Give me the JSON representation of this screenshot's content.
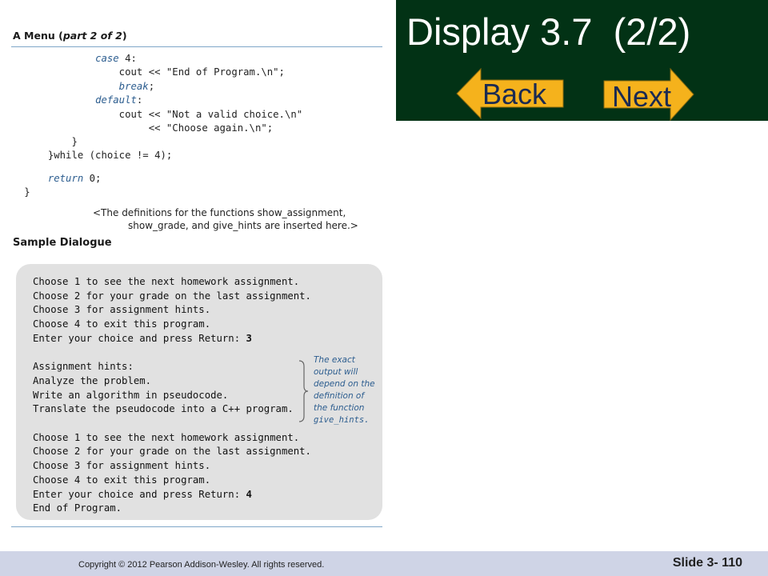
{
  "figure": {
    "title_prefix": "A Menu (",
    "title_italic": "part 2 of 2",
    "title_suffix": ")",
    "code_lines": [
      {
        "indent": "               ",
        "kw": "case",
        "rest": " 4:"
      },
      {
        "indent": "                   ",
        "kw": "",
        "rest": "cout << \"End of Program.\\n\";"
      },
      {
        "indent": "                   ",
        "kw": "break",
        "rest": ";"
      },
      {
        "indent": "               ",
        "kw": "default",
        "rest": ":"
      },
      {
        "indent": "                   ",
        "kw": "",
        "rest": "cout << \"Not a valid choice.\\n\""
      },
      {
        "indent": "                        ",
        "kw": "",
        "rest": "<< \"Choose again.\\n\";"
      },
      {
        "indent": "           ",
        "kw": "",
        "rest": "}"
      },
      {
        "indent": "       ",
        "kw": "",
        "rest": "}while (choice != 4);"
      },
      {
        "indent": "",
        "kw": "",
        "rest": ""
      },
      {
        "indent": "       ",
        "kw": "return",
        "rest": " 0;"
      },
      {
        "indent": "   ",
        "kw": "",
        "rest": "}"
      }
    ],
    "note_line1": "<The definitions for the functions show_assignment,",
    "note_line2": "show_grade, and give_hints are inserted here.>",
    "sample_title": "Sample Dialogue",
    "dialogue_lines": [
      {
        "text": "Choose 1 to see the next homework assignment.",
        "input": ""
      },
      {
        "text": "Choose 2 for your grade on the last assignment.",
        "input": ""
      },
      {
        "text": "Choose 3 for assignment hints.",
        "input": ""
      },
      {
        "text": "Choose 4 to exit this program.",
        "input": ""
      },
      {
        "text": "Enter your choice and press Return: ",
        "input": "3"
      },
      {
        "text": "",
        "input": ""
      },
      {
        "text": "Assignment hints:",
        "input": ""
      },
      {
        "text": "Analyze the problem.",
        "input": ""
      },
      {
        "text": "Write an algorithm in pseudocode.",
        "input": ""
      },
      {
        "text": "Translate the pseudocode into a C++ program.",
        "input": ""
      },
      {
        "text": "",
        "input": ""
      },
      {
        "text": "Choose 1 to see the next homework assignment.",
        "input": ""
      },
      {
        "text": "Choose 2 for your grade on the last assignment.",
        "input": ""
      },
      {
        "text": "Choose 3 for assignment hints.",
        "input": ""
      },
      {
        "text": "Choose 4 to exit this program.",
        "input": ""
      },
      {
        "text": "Enter your choice and press Return: ",
        "input": "4"
      },
      {
        "text": "End of Program.",
        "input": ""
      }
    ],
    "annotation_lines": [
      "The exact",
      "output will",
      "depend on the",
      "definition of",
      "the function"
    ],
    "annotation_func": "give_hints."
  },
  "slide": {
    "title": "Display 3.7  (2/2)",
    "back_label": "Back",
    "next_label": "Next"
  },
  "footer": {
    "copyright": "Copyright © 2012 Pearson Addison-Wesley.  All rights reserved.",
    "slide_number": "Slide 3- 110"
  },
  "colors": {
    "title_bg": "#023215",
    "nav_fill": "#f5b21c",
    "nav_text": "#1b2a52",
    "footer_bg": "#cfd4e6",
    "dialogue_bg": "#e1e1e1",
    "annotation": "#2c5d8f"
  }
}
